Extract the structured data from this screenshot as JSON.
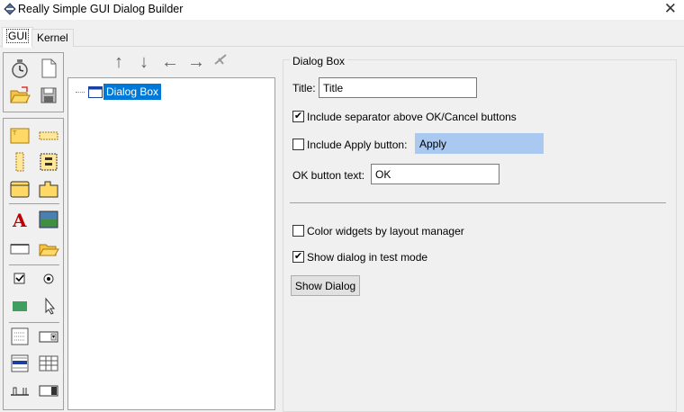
{
  "window": {
    "title": "Really Simple GUI Dialog Builder",
    "close_glyph": "✕"
  },
  "tabs": [
    {
      "label": "GUI",
      "active": true
    },
    {
      "label": "Kernel",
      "active": false
    }
  ],
  "arrows": [
    "↑",
    "↓",
    "←",
    "→"
  ],
  "tree": {
    "root_label": "Dialog Box"
  },
  "form": {
    "group_title": "Dialog Box",
    "title_label": "Title:",
    "title_value": "Title",
    "separator_label": "Include separator above OK/Cancel buttons",
    "separator_checked": true,
    "apply_label": "Include Apply button:",
    "apply_checked": false,
    "apply_value": "Apply",
    "ok_label": "OK button text:",
    "ok_value": "OK",
    "color_widgets_label": "Color widgets by layout manager",
    "color_widgets_checked": false,
    "test_mode_label": "Show dialog in test mode",
    "test_mode_checked": true,
    "show_dialog_button": "Show Dialog"
  },
  "colors": {
    "accent": "#0078d7",
    "highlight": "#a9c9f0",
    "folder": "#ffd966"
  }
}
